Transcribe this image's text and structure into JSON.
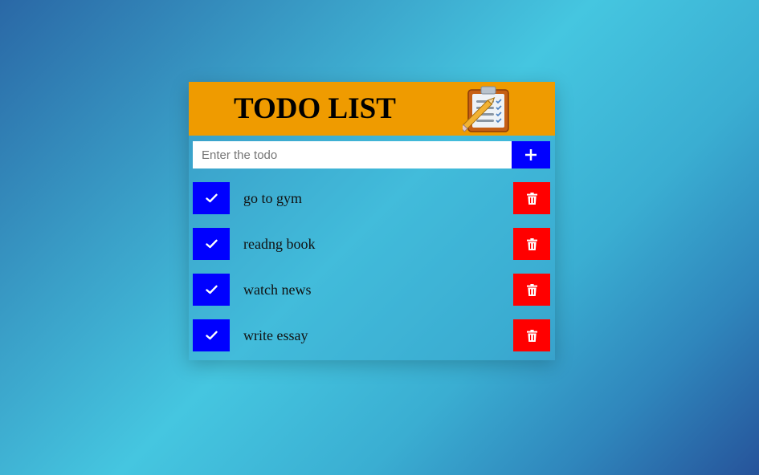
{
  "header": {
    "title": "TODO LIST",
    "logo_icon": "clipboard-pencil-icon"
  },
  "input": {
    "placeholder": "Enter the todo",
    "value": "",
    "add_icon": "plus-icon"
  },
  "todos": [
    {
      "text": "go to gym"
    },
    {
      "text": "readng book"
    },
    {
      "text": "watch news"
    },
    {
      "text": "write essay"
    }
  ],
  "icons": {
    "complete": "check-icon",
    "delete": "trash-icon"
  },
  "colors": {
    "header_bg": "#ef9b00",
    "primary_button": "#0000ff",
    "delete_button": "#ff0000",
    "input_bg": "#ffffff"
  }
}
